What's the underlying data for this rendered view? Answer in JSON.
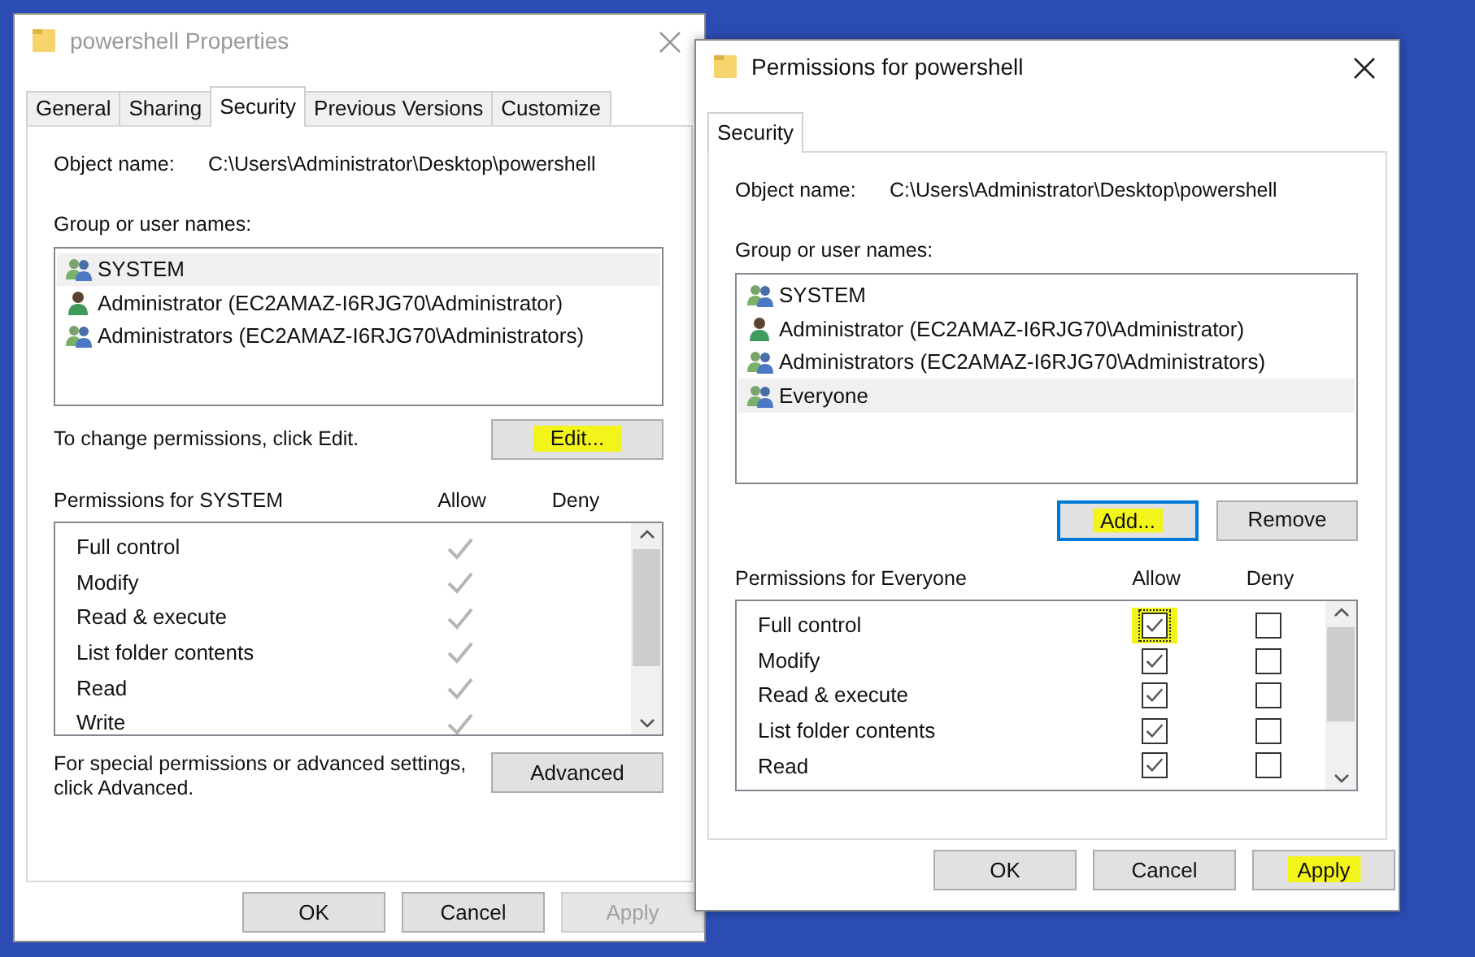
{
  "windows": [
    {
      "kind": "properties",
      "title": "powershell Properties",
      "active": false,
      "tabs": [
        {
          "label": "General",
          "selected": false
        },
        {
          "label": "Sharing",
          "selected": false
        },
        {
          "label": "Security",
          "selected": true
        },
        {
          "label": "Previous Versions",
          "selected": false
        },
        {
          "label": "Customize",
          "selected": false
        }
      ],
      "object_name_label": "Object name:",
      "object_name": "C:\\Users\\Administrator\\Desktop\\powershell",
      "group_label": "Group or user names:",
      "users": [
        {
          "name": "SYSTEM",
          "kind": "group",
          "selected": true
        },
        {
          "name": "Administrator (EC2AMAZ-I6RJG70\\Administrator)",
          "kind": "user",
          "selected": false
        },
        {
          "name": "Administrators (EC2AMAZ-I6RJG70\\Administrators)",
          "kind": "group",
          "selected": false
        }
      ],
      "change_hint": "To change permissions, click Edit.",
      "user_buttons": [
        {
          "label": "Edit...",
          "highlighted": true,
          "focused": false
        }
      ],
      "permissions_label": "Permissions for SYSTEM",
      "allow_label": "Allow",
      "deny_label": "Deny",
      "permissions": [
        {
          "name": "Full control",
          "kind": "readonly",
          "allow": true
        },
        {
          "name": "Modify",
          "kind": "readonly",
          "allow": true
        },
        {
          "name": "Read & execute",
          "kind": "readonly",
          "allow": true
        },
        {
          "name": "List folder contents",
          "kind": "readonly",
          "allow": true
        },
        {
          "name": "Read",
          "kind": "readonly",
          "allow": true
        },
        {
          "name": "Write",
          "kind": "readonly",
          "allow": true
        }
      ],
      "advanced_text": "For special permissions or advanced settings, click Advanced.",
      "advanced_button": "Advanced",
      "buttons": [
        {
          "label": "OK",
          "disabled": false,
          "highlighted": false
        },
        {
          "label": "Cancel",
          "disabled": false,
          "highlighted": false
        },
        {
          "label": "Apply",
          "disabled": true,
          "highlighted": false
        }
      ]
    },
    {
      "kind": "permissions",
      "title": "Permissions for powershell",
      "active": true,
      "tabs": [
        {
          "label": "Security",
          "selected": true
        }
      ],
      "object_name_label": "Object name:",
      "object_name": "C:\\Users\\Administrator\\Desktop\\powershell",
      "group_label": "Group or user names:",
      "users": [
        {
          "name": "SYSTEM",
          "kind": "group",
          "selected": false
        },
        {
          "name": "Administrator (EC2AMAZ-I6RJG70\\Administrator)",
          "kind": "user",
          "selected": false
        },
        {
          "name": "Administrators (EC2AMAZ-I6RJG70\\Administrators)",
          "kind": "group",
          "selected": false
        },
        {
          "name": "Everyone",
          "kind": "group",
          "selected": true
        }
      ],
      "user_buttons": [
        {
          "label": "Add...",
          "highlighted": true,
          "focused": true
        },
        {
          "label": "Remove",
          "highlighted": false,
          "focused": false
        }
      ],
      "permissions_label": "Permissions for Everyone",
      "allow_label": "Allow",
      "deny_label": "Deny",
      "permissions": [
        {
          "name": "Full control",
          "kind": "checkbox",
          "allow": true,
          "deny": false,
          "highlighted": true
        },
        {
          "name": "Modify",
          "kind": "checkbox",
          "allow": true,
          "deny": false
        },
        {
          "name": "Read & execute",
          "kind": "checkbox",
          "allow": true,
          "deny": false
        },
        {
          "name": "List folder contents",
          "kind": "checkbox",
          "allow": true,
          "deny": false
        },
        {
          "name": "Read",
          "kind": "checkbox",
          "allow": true,
          "deny": false
        }
      ],
      "buttons": [
        {
          "label": "OK",
          "disabled": false,
          "highlighted": false
        },
        {
          "label": "Cancel",
          "disabled": false,
          "highlighted": false
        },
        {
          "label": "Apply",
          "disabled": false,
          "highlighted": true
        }
      ]
    }
  ]
}
